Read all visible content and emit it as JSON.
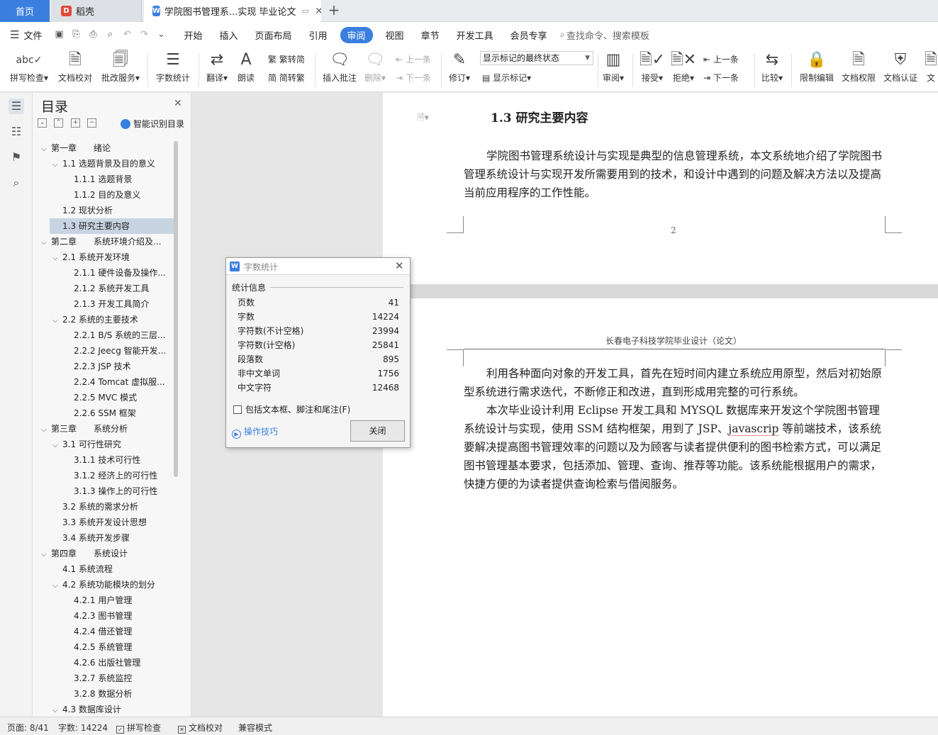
{
  "tabs": {
    "home": "首页",
    "daoke": "稻壳",
    "doc": "学院图书管理系...实现 毕业论文",
    "new_tab": "+"
  },
  "menu": {
    "file": "文件",
    "items": [
      "开始",
      "插入",
      "页面布局",
      "引用",
      "审阅",
      "视图",
      "章节",
      "开发工具",
      "会员专享"
    ],
    "active": "审阅",
    "search_placeholder": "查找命令、搜索模板"
  },
  "toolbar": {
    "spell_check": "拼写检查",
    "doc_proof": "文档校对",
    "revise_service": "批改服务",
    "word_count": "字数统计",
    "translate": "翻译",
    "read_aloud": "朗读",
    "trad_convert": "繁转简",
    "simp_convert": "简转繁",
    "insert_comment": "插入批注",
    "delete": "删除",
    "prev_comment": "上一条",
    "next_comment": "下一条",
    "track": "修订",
    "markup_state": "显示标记的最终状态",
    "show_markup": "显示标记",
    "review": "审阅",
    "accept": "接受",
    "reject": "拒绝",
    "prev_change": "上一条",
    "next_change": "下一条",
    "compare": "比较",
    "restrict_edit": "限制编辑",
    "doc_permission": "文档权限",
    "doc_cert": "文档认证",
    "doc_more": "文"
  },
  "toc": {
    "title": "目录",
    "smart_label": "智能识别目录",
    "items": [
      {
        "level": 1,
        "text": "第一章　　绪论",
        "open": true
      },
      {
        "level": 2,
        "text": "1.1  选题背景及目的意义",
        "open": true
      },
      {
        "level": 3,
        "text": "1.1.1  选题背景"
      },
      {
        "level": 3,
        "text": "1.1.2  目的及意义"
      },
      {
        "level": 2,
        "text": "1.2  现状分析"
      },
      {
        "level": 2,
        "text": "1.3  研究主要内容",
        "selected": true
      },
      {
        "level": 1,
        "text": "第二章　　系统环境介绍及...",
        "open": true
      },
      {
        "level": 2,
        "text": "2.1  系统开发环境",
        "open": true
      },
      {
        "level": 3,
        "text": "2.1.1  硬件设备及操作..."
      },
      {
        "level": 3,
        "text": "2.1.2  系统开发工具"
      },
      {
        "level": 3,
        "text": "2.1.3  开发工具简介"
      },
      {
        "level": 2,
        "text": "2.2  系统的主要技术",
        "open": true
      },
      {
        "level": 3,
        "text": "2.2.1 B/S 系统的三层..."
      },
      {
        "level": 3,
        "text": "2.2.2 Jeecg 智能开发..."
      },
      {
        "level": 3,
        "text": "2.2.3 JSP 技术"
      },
      {
        "level": 3,
        "text": "2.2.4 Tomcat 虚拟服..."
      },
      {
        "level": 3,
        "text": "2.2.5 MVC 模式"
      },
      {
        "level": 3,
        "text": "2.2.6 SSM 框架"
      },
      {
        "level": 1,
        "text": "第三章　　系统分析",
        "open": true
      },
      {
        "level": 2,
        "text": "3.1  可行性研究",
        "open": true
      },
      {
        "level": 3,
        "text": "3.1.1  技术可行性"
      },
      {
        "level": 3,
        "text": "3.1.2  经济上的可行性"
      },
      {
        "level": 3,
        "text": "3.1.3  操作上的可行性"
      },
      {
        "level": 2,
        "text": "3.2  系统的需求分析"
      },
      {
        "level": 2,
        "text": "3.3  系统开发设计思想"
      },
      {
        "level": 2,
        "text": "3.4  系统开发步骤"
      },
      {
        "level": 1,
        "text": "第四章　　系统设计",
        "open": true
      },
      {
        "level": 2,
        "text": "4.1 系统流程"
      },
      {
        "level": 2,
        "text": "4.2  系统功能模块的划分",
        "open": true
      },
      {
        "level": 3,
        "text": "4.2.1 用户管理"
      },
      {
        "level": 3,
        "text": "4.2.3  图书管理"
      },
      {
        "level": 3,
        "text": "4.2.4  借还管理"
      },
      {
        "level": 3,
        "text": "4.2.5  系统管理"
      },
      {
        "level": 3,
        "text": "4.2.6  出版社管理"
      },
      {
        "level": 3,
        "text": "3.2.7  系统监控"
      },
      {
        "level": 3,
        "text": "3.2.8  数据分析"
      },
      {
        "level": 2,
        "text": "4.3 数据库设计",
        "open": true
      }
    ]
  },
  "document": {
    "heading": "1.3  研究主要内容",
    "para1": "学院图书管理系统设计与实现是典型的信息管理系统，本文系统地介绍了学院图书管理系统设计与实现开发所需要用到的技术，和设计中遇到的问题及解决方法以及提高当前应用程序的工作性能。",
    "page_number": "2",
    "running_header": "长春电子科技学院毕业设计（论文）",
    "para2": "利用各种面向对象的开发工具，首先在短时间内建立系统应用原型，然后对初始原型系统进行需求迭代，不断修正和改进，直到形成用完整的可行系统。",
    "para3_a": "本次毕业设计利用 Eclipse 开发工具和 MYSQL 数据库来开发这个学院图书管理系统设计与实现，使用 SSM 结构框架，用到了 JSP、",
    "para3_squiggle": "javascrip",
    "para3_b": " 等前端技术，该系统要解决提高图书管理效率的问题以及为顾客与读者提供便利的图书检索方式，可以满足图书管理基本要求，包括添加、管理、查询、推荐等功能。该系统能根据用户的需求，快捷方便的为读者提供查询检索与借阅服务。"
  },
  "dialog": {
    "title": "字数统计",
    "section": "统计信息",
    "stats": [
      {
        "label": "页数",
        "value": "41"
      },
      {
        "label": "字数",
        "value": "14224"
      },
      {
        "label": "字符数(不计空格)",
        "value": "23994"
      },
      {
        "label": "字符数(计空格)",
        "value": "25841"
      },
      {
        "label": "段落数",
        "value": "895"
      },
      {
        "label": "非中文单词",
        "value": "1756"
      },
      {
        "label": "中文字符",
        "value": "12468"
      }
    ],
    "include_label": "包括文本框、脚注和尾注(F)",
    "tips": "操作技巧",
    "close": "关闭"
  },
  "status": {
    "page": "页面: 8/41",
    "words": "字数: 14224",
    "spell": "拼写检查",
    "proof": "文档校对",
    "compat": "兼容模式"
  },
  "colors": {
    "accent": "#3a7fe0",
    "toc_selected": "#c8d4e2",
    "squiggle": "#dd2222"
  }
}
